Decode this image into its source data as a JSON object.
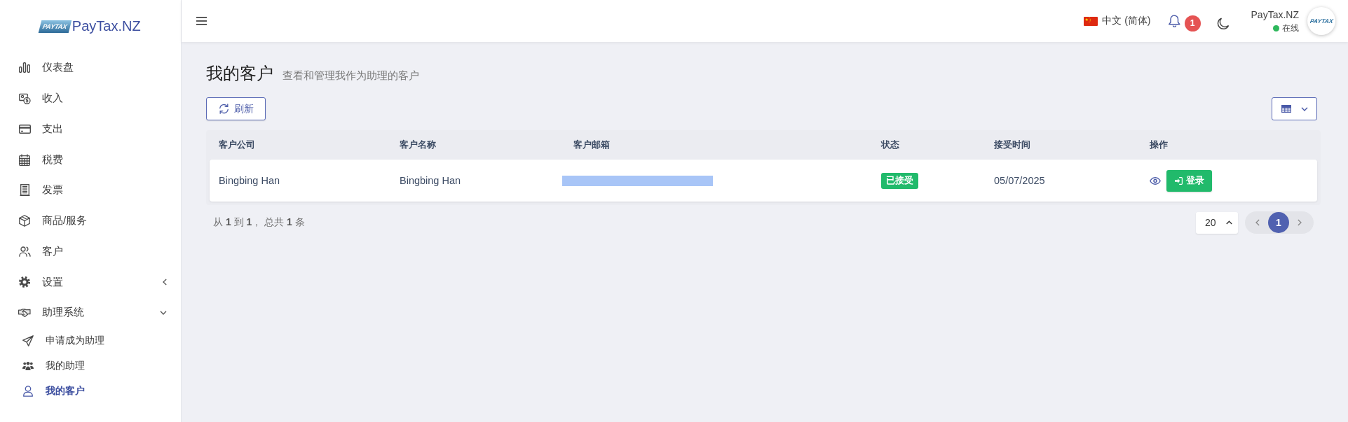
{
  "sidebar": {
    "logo": {
      "mark": "PAYTAX",
      "text": "PayTax.NZ"
    },
    "items": [
      {
        "kind": "link",
        "label": "仪表盘",
        "selected": false
      },
      {
        "kind": "link",
        "label": "收入",
        "selected": false
      },
      {
        "kind": "link",
        "label": "支出",
        "selected": false
      },
      {
        "kind": "link",
        "label": "税费",
        "selected": false
      },
      {
        "kind": "link",
        "label": "发票",
        "selected": false
      },
      {
        "kind": "link",
        "label": "商品/服务",
        "selected": false
      },
      {
        "kind": "link",
        "label": "客户",
        "selected": false
      },
      {
        "kind": "group",
        "label": "设置",
        "expanded": false,
        "selected": false
      },
      {
        "kind": "group",
        "label": "助理系统",
        "expanded": true,
        "selected": false,
        "children": [
          {
            "label": "申请成为助理",
            "selected": false
          },
          {
            "label": "我的助理",
            "selected": false
          },
          {
            "label": "我的客户",
            "selected": true
          }
        ]
      }
    ]
  },
  "header": {
    "language": "中文 (简体)",
    "notifications": {
      "count": "1"
    },
    "user": {
      "name": "PayTax.NZ",
      "status": "在线",
      "online": true,
      "avatar_mark": "PAYTAX"
    }
  },
  "page": {
    "title": "我的客户",
    "subtitle": "查看和管理我作为助理的客户",
    "refresh_button": "刷新"
  },
  "table": {
    "columns": [
      "客户公司",
      "客户名称",
      "客户邮箱",
      "状态",
      "接受时间",
      "操作"
    ],
    "rows": [
      {
        "cells": [
          {
            "kind": "text",
            "text": "Bingbing Han"
          },
          {
            "kind": "text",
            "text": "Bingbing Han"
          },
          {
            "kind": "redacted"
          },
          {
            "kind": "badge",
            "text": "已接受",
            "color": "#21ba6b"
          },
          {
            "kind": "text",
            "text": "05/07/2025"
          },
          {
            "kind": "actions",
            "button": "登录"
          }
        ]
      }
    ]
  },
  "footer": {
    "summary": "从 **1** 到 **1**， 总共 **1** 条",
    "page_size": "20",
    "pages": [
      {
        "label": "1",
        "selected": true
      }
    ]
  }
}
